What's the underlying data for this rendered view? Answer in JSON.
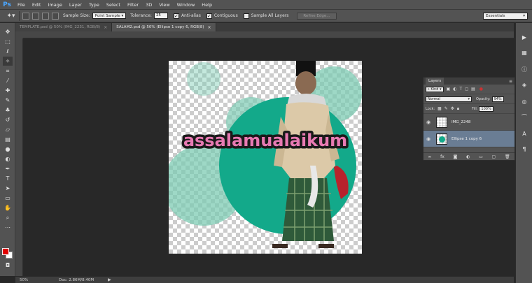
{
  "app": {
    "logo": "Ps"
  },
  "menu": [
    "File",
    "Edit",
    "Image",
    "Layer",
    "Type",
    "Select",
    "Filter",
    "3D",
    "View",
    "Window",
    "Help"
  ],
  "options": {
    "sample_size_label": "Sample Size:",
    "sample_size_value": "Point Sample",
    "tolerance_label": "Tolerance:",
    "tolerance_value": "25",
    "anti_alias_label": "Anti-alias",
    "contiguous_label": "Contiguous",
    "sample_all_label": "Sample All Layers",
    "refine_edge_label": "Refine Edge...",
    "workspace": "Essentials"
  },
  "tabs": [
    {
      "label": "TEMPLATE.psd @ 50% (IMG_2231, RGB/8)",
      "close": "×"
    },
    {
      "label": "SALAM2.psd @ 50% (Ellipse 1 copy 6, RGB/8)",
      "close": "×"
    }
  ],
  "canvas": {
    "greeting": "assalamualaikum",
    "colors": {
      "accent": "#13a98a",
      "light": "#7dcbb3",
      "pink": "#e87ab3"
    }
  },
  "status": {
    "zoom": "50%",
    "doc": "Doc: 2.86M/8.40M",
    "arrow": "▶"
  },
  "layers_panel": {
    "tab_label": "Layers",
    "filter_kind": "Kind",
    "blend_mode": "Normal",
    "opacity_label": "Opacity:",
    "opacity_value": "94%",
    "lock_label": "Lock:",
    "fill_label": "Fill:",
    "fill_value": "100%",
    "layers": [
      {
        "name": "IMG_2248",
        "selected": false
      },
      {
        "name": "Ellipse 1 copy 6",
        "selected": true
      }
    ],
    "footer_icons": [
      "link-icon",
      "fx-icon",
      "mask-icon",
      "adjustment-icon",
      "group-icon",
      "new-layer-icon",
      "trash-icon"
    ]
  }
}
